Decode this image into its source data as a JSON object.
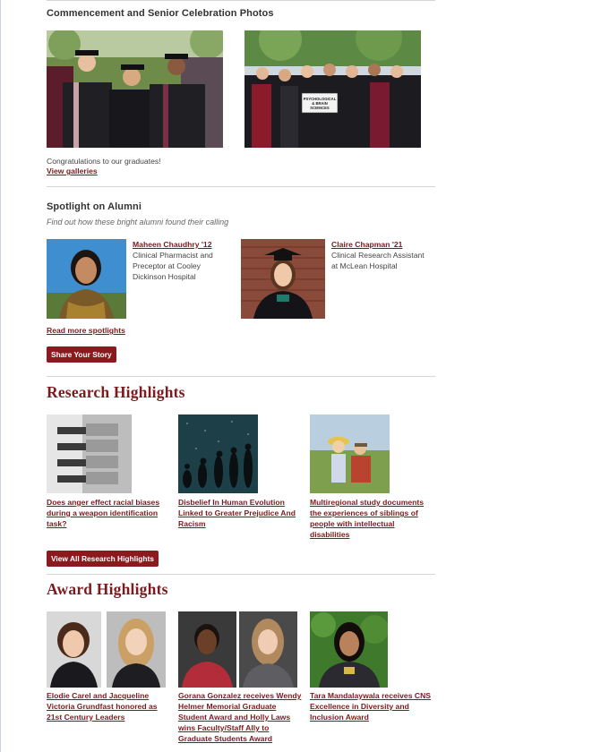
{
  "commencement": {
    "heading": "Commencement and Senior Celebration Photos",
    "caption": "Congratulations to our graduates!",
    "link": "View galleries",
    "sign_text": "PSYCHOLOGICAL & BRAIN SCIENCES"
  },
  "alumni": {
    "heading": "Spotlight on Alumni",
    "subtitle": "Find out how these bright alumni found their calling",
    "people": [
      {
        "name": "Maheen Chaudhry '12",
        "desc_lines": [
          "Clinical Pharmacist and",
          "Preceptor at Cooley",
          "Dickinson Hospital"
        ]
      },
      {
        "name": "Claire Chapman '21",
        "desc_lines": [
          "Clinical Research Assistant",
          "at McLean Hospital"
        ]
      }
    ],
    "more_link": "Read more spotlights",
    "button": "Share Your Story"
  },
  "research": {
    "heading": "Research Highlights",
    "items": [
      {
        "title_lines": [
          "Does anger effect racial biases",
          "during a weapon identification",
          "task?"
        ]
      },
      {
        "title_lines": [
          "Disbelief In Human Evolution",
          "Linked to Greater Prejudice And",
          "Racism"
        ]
      },
      {
        "title_lines": [
          "Multiregional study documents",
          "the experiences of siblings of",
          "people with intellectual",
          "disabilities"
        ]
      }
    ],
    "button": "View All Research Highlights"
  },
  "awards": {
    "heading": "Award Highlights",
    "items": [
      {
        "title_lines": [
          "Elodie Carel and Jacqueline",
          "Victoria Grundfast honored as",
          "21st Century Leaders"
        ]
      },
      {
        "title_lines": [
          "Gorana Gonzalez receives Wendy",
          "Helmer Memorial Graduate",
          "Student Award and Holly Laws",
          "wins Faculty/Staff Ally to",
          "Graduate Students Award"
        ]
      },
      {
        "title_lines": [
          "Tara Mandalaywala receives CNS",
          "Excellence in Diversity and",
          "Inclusion Award"
        ]
      }
    ]
  },
  "colors": {
    "brand": "#7d1a1d",
    "button": "#8b1a1f",
    "rule": "#d6d6d6"
  }
}
